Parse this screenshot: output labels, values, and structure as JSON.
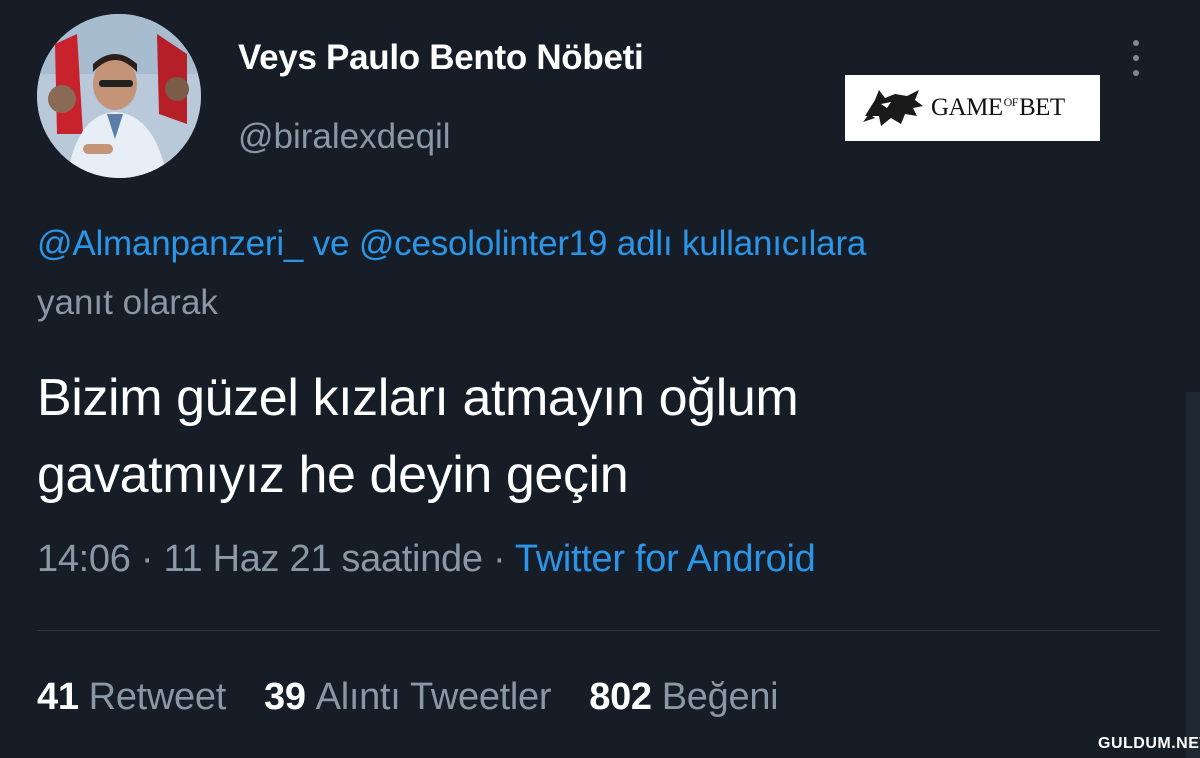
{
  "tweet": {
    "display_name": "Veys Paulo Bento Nöbeti",
    "handle": "@biralexdeqil",
    "reply": {
      "mention1": "@Almanpanzeri_",
      "connector": " ve ",
      "mention2": "@cesololinter19",
      "suffix": " adlı kullanıcılara",
      "line2": "yanıt olarak"
    },
    "text_line1": "Bizim güzel kızları atmayın oğlum",
    "text_line2": "gavatmıyız he deyin geçin",
    "time": "14:06",
    "sep1": " · ",
    "date": "11 Haz 21 saatinde",
    "sep2": " · ",
    "source": "Twitter for Android"
  },
  "stats": {
    "retweets": {
      "count": "41",
      "label": "Retweet"
    },
    "quotes": {
      "count": "39",
      "label": "Alıntı Tweetler"
    },
    "likes": {
      "count": "802",
      "label": "Beğeni"
    }
  },
  "watermark": {
    "logo_text_a": "GAME",
    "logo_text_of": "OF",
    "logo_text_b": "BET",
    "icon": "wolf-icon"
  },
  "site_mark": "GULDUM.NET",
  "colors": {
    "background": "#161d27",
    "text": "#ffffff",
    "muted": "#8a97a5",
    "link": "#2b95e8"
  }
}
